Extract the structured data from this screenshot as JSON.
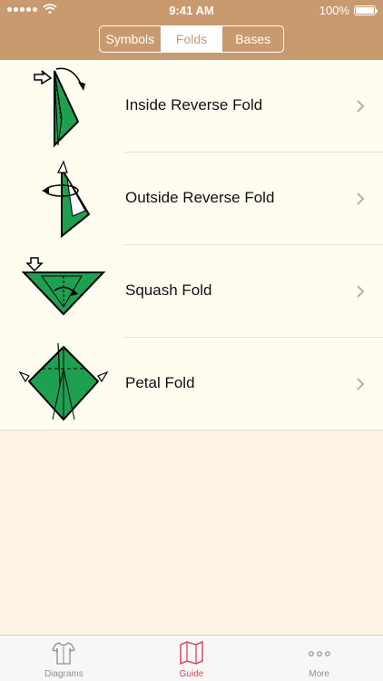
{
  "status": {
    "time": "9:41 AM",
    "battery": "100%"
  },
  "segments": [
    {
      "label": "Symbols",
      "active": false
    },
    {
      "label": "Folds",
      "active": true
    },
    {
      "label": "Bases",
      "active": false
    }
  ],
  "folds": [
    {
      "label": "Inside Reverse Fold",
      "icon": "inside-reverse-fold-icon"
    },
    {
      "label": "Outside Reverse Fold",
      "icon": "outside-reverse-fold-icon"
    },
    {
      "label": "Squash Fold",
      "icon": "squash-fold-icon"
    },
    {
      "label": "Petal Fold",
      "icon": "petal-fold-icon"
    }
  ],
  "tabs": [
    {
      "label": "Diagrams",
      "icon": "shirt-icon",
      "active": false
    },
    {
      "label": "Guide",
      "icon": "map-icon",
      "active": true
    },
    {
      "label": "More",
      "icon": "more-icon",
      "active": false
    }
  ],
  "colors": {
    "header": "#c89a6e",
    "paper_green": "#1da150",
    "accent": "#d4485e",
    "background": "#fdf4e6"
  }
}
